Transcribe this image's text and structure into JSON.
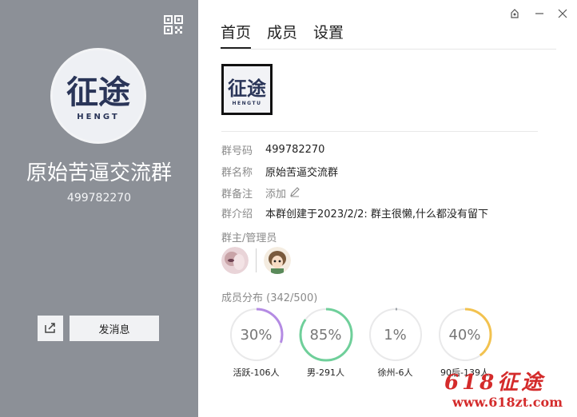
{
  "left": {
    "group_name": "原始苦逼交流群",
    "group_id": "499782270",
    "avatar_text": "征途",
    "avatar_subtext": "HENGT",
    "send_message_label": "发消息"
  },
  "tabs": [
    {
      "label": "首页",
      "active": true
    },
    {
      "label": "成员",
      "active": false
    },
    {
      "label": "设置",
      "active": false
    }
  ],
  "logo": {
    "text": "征途",
    "subtext": "HENGTU"
  },
  "info": {
    "group_number_key": "群号码",
    "group_number_val": "499782270",
    "group_name_key": "群名称",
    "group_name_val": "原始苦逼交流群",
    "remark_key": "群备注",
    "remark_val": "添加",
    "intro_key": "群介绍",
    "intro_val": "本群创建于2023/2/2:  群主很懒,什么都没有留下"
  },
  "admins_label": "群主/管理员",
  "distribution_label": "成员分布 (342/500)",
  "stats": [
    {
      "percent": "30%",
      "fraction": 0.3,
      "label": "活跃-106人",
      "color": "#b48be3"
    },
    {
      "percent": "85%",
      "fraction": 0.85,
      "label": "男-291人",
      "color": "#6fcf9a"
    },
    {
      "percent": "1%",
      "fraction": 0.01,
      "label": "徐州-6人",
      "color": "#9aa0a6"
    },
    {
      "percent": "40%",
      "fraction": 0.4,
      "label": "90后-139人",
      "color": "#f2c24f"
    }
  ],
  "watermark": {
    "line1": "618征途",
    "line2": "www.618zt.com"
  },
  "colors": {
    "left_panel": "#8c9097",
    "accent_text": "#222222"
  }
}
